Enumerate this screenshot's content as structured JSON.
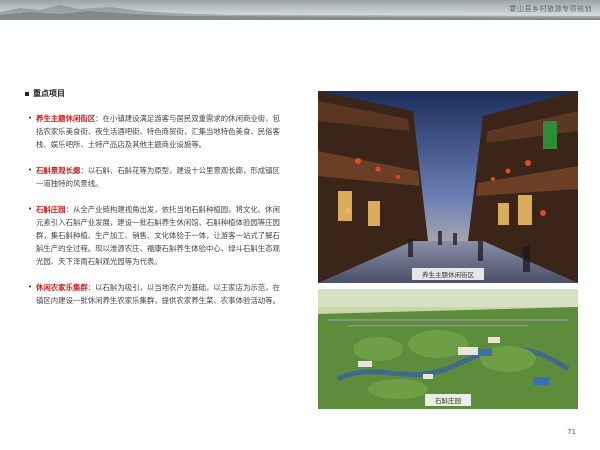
{
  "header": {
    "title": "霍山县乡村旅游专项规划"
  },
  "section": {
    "title": "重点项目"
  },
  "items": [
    {
      "name": "养生主题休闲街区",
      "text": "：在小镇建设满足游客与居民双重需求的休闲商业街，包括农家乐美食街、夜生活酒吧街、特色商贸街，汇集当地特色美食、民俗客栈、娱乐吧所、土特产品店及其他主题商业设施等。"
    },
    {
      "name": "石斛景观长廊",
      "text": "：以石斛、石斛花等为原型，建设十公里景观长廊，形成镇区一道独特的风景线。"
    },
    {
      "name": "石斛庄园",
      "text": "：从全产业链构建视角出发，依托当地石斛种植园，将文化、休闲元素引入石斛产业发展，建设一批石斛养生休闲馆、石斛种植体验园等庄园群，集石斛种植、生产加工、销售、文化体验于一体，让游客一站式了解石斛生产的全过程。现以淮源农庄、福康石斛养生体验中心、绿斗石斛生态观光园、天下泽雨石斛观光园等为代表。"
    },
    {
      "name": "休闲农家乐集群",
      "text": "：以石斛为吸引，以当地农户为基础，以王家店为示范，在镇区内建设一批休闲养生农家乐集群，提供农家养生菜、农事体验活动等。"
    }
  ],
  "photos": [
    {
      "caption": "养生主题休闲街区"
    },
    {
      "caption": "石斛庄园"
    }
  ],
  "page": {
    "number": "71"
  }
}
